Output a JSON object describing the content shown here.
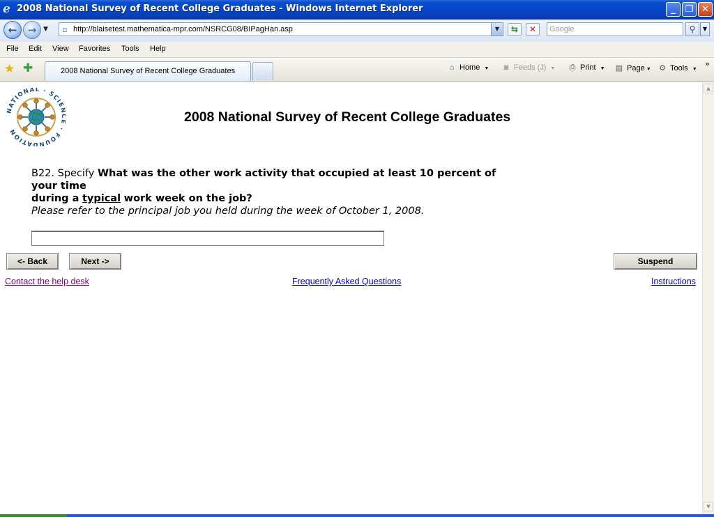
{
  "window": {
    "title": "2008 National Survey of Recent College Graduates - Windows Internet Explorer",
    "minimize": "_",
    "maximize": "❐",
    "close": "✕"
  },
  "address_bar": {
    "url": "http://blaisetest.mathematica-mpr.com/NSRCG08/BIPagHan.asp",
    "search_placeholder": "Google"
  },
  "menu": [
    "File",
    "Edit",
    "View",
    "Favorites",
    "Tools",
    "Help"
  ],
  "tab": {
    "label": "2008 National Survey of Recent College Graduates"
  },
  "commands": {
    "home": "Home",
    "feeds": "Feeds (J)",
    "print": "Print",
    "page": "Page",
    "tools": "Tools"
  },
  "page": {
    "logo_text": {
      "arc": "NATIONAL · SCIENCE · FOUNDATION"
    },
    "survey_title": "2008 National Survey of Recent College Graduates",
    "question": {
      "number": "B22.",
      "lead": "Specify",
      "bold_1": "What was the other work activity that occupied at least 10 percent of your time",
      "bold_2": "during a",
      "underlined": "typical",
      "bold_3": "work week on the job?"
    },
    "instruction": "Please refer to the principal job you held during the week of October 1, 2008.",
    "answer_value": "",
    "buttons": {
      "back": "<- Back",
      "next": "Next ->",
      "suspend": "Suspend"
    },
    "links": {
      "help_desk": "Contact the help desk",
      "faq": "Frequently Asked Questions",
      "instructions": "Instructions"
    }
  },
  "colors": {
    "link_visited": "#800080",
    "link": "#0000cc",
    "titlebar": "#0545c9"
  }
}
